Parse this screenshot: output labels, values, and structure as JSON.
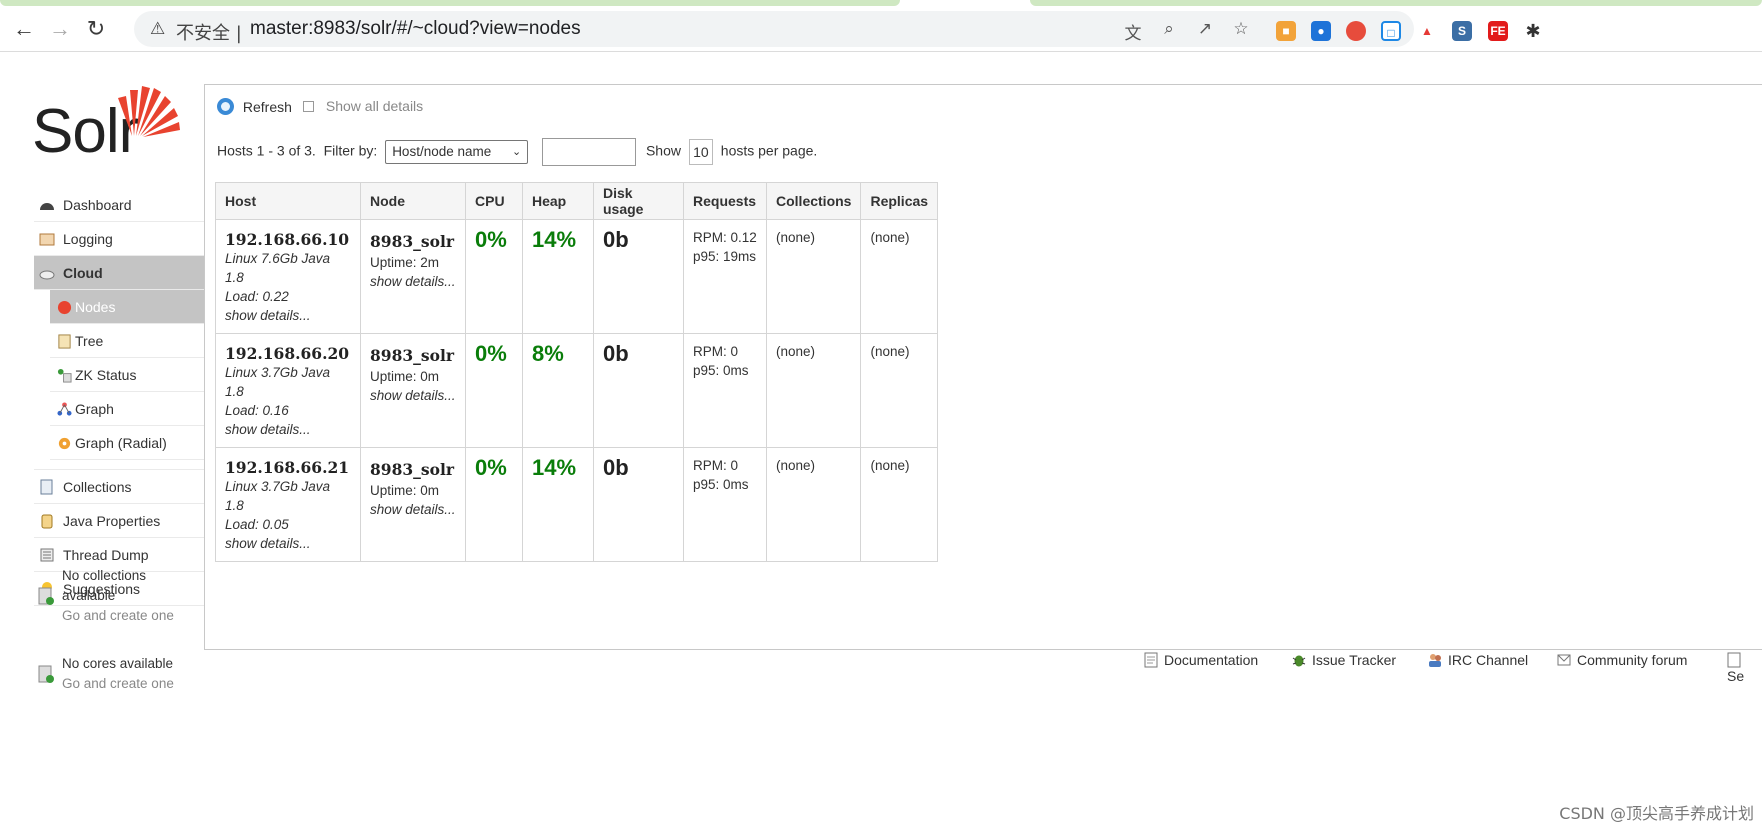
{
  "browser": {
    "insecure_label": "不安全 |",
    "url": "master:8983/solr/#/~cloud?view=nodes",
    "back_icon": "back-arrow-icon",
    "forward_icon": "forward-arrow-icon",
    "reload_icon": "reload-icon",
    "extension_colors": [
      "#f2a33a",
      "#1e73d8",
      "#e74c3c",
      "#1e88e5",
      "#e53935",
      "#3b6ea5",
      "#e21b1b",
      "#333333"
    ]
  },
  "logo": {
    "text": "Solr",
    "accent": "#e8432f"
  },
  "sidebar": {
    "items": [
      {
        "label": "Dashboard",
        "icon": "dashboard-icon"
      },
      {
        "label": "Logging",
        "icon": "logging-icon"
      },
      {
        "label": "Cloud",
        "icon": "cloud-icon",
        "active": true
      }
    ],
    "cloud_sub": [
      {
        "label": "Nodes",
        "icon": "nodes-icon",
        "active": true
      },
      {
        "label": "Tree",
        "icon": "tree-icon"
      },
      {
        "label": "ZK Status",
        "icon": "zk-status-icon"
      },
      {
        "label": "Graph",
        "icon": "graph-icon"
      },
      {
        "label": "Graph (Radial)",
        "icon": "graph-radial-icon"
      }
    ],
    "more_items": [
      {
        "label": "Collections",
        "icon": "collections-icon"
      },
      {
        "label": "Java Properties",
        "icon": "java-properties-icon"
      },
      {
        "label": "Thread Dump",
        "icon": "thread-dump-icon"
      },
      {
        "label": "Suggestions",
        "icon": "suggestions-icon"
      }
    ],
    "no_collections": "No collections available",
    "no_collections_link": "Go and create one",
    "no_cores": "No cores available",
    "no_cores_link": "Go and create one"
  },
  "toolbar": {
    "refresh_label": "Refresh",
    "show_all_label": "Show all details",
    "hosts_summary": "Hosts 1 - 3 of 3.",
    "filter_label": "Filter by:",
    "filter_value": "Host/node name",
    "filter_input": "",
    "show_label": "Show",
    "per_page": "10",
    "per_page_suffix": "hosts per page."
  },
  "table": {
    "headers": [
      "Host",
      "Node",
      "CPU",
      "Heap",
      "Disk usage",
      "Requests",
      "Collections",
      "Replicas"
    ],
    "rows": [
      {
        "host": "192.168.66.10",
        "os": "Linux 7.6Gb Java 1.8",
        "load": "Load: 0.22",
        "host_details": "show details...",
        "node": "8983_solr",
        "uptime": "Uptime: 2m",
        "node_details": "show details...",
        "cpu": "0%",
        "heap": "14%",
        "disk": "0b",
        "rpm": "RPM: 0.12",
        "p95": "p95: 19ms",
        "collections": "(none)",
        "replicas": "(none)"
      },
      {
        "host": "192.168.66.20",
        "os": "Linux 3.7Gb Java 1.8",
        "load": "Load: 0.16",
        "host_details": "show details...",
        "node": "8983_solr",
        "uptime": "Uptime: 0m",
        "node_details": "show details...",
        "cpu": "0%",
        "heap": "8%",
        "disk": "0b",
        "rpm": "RPM: 0",
        "p95": "p95: 0ms",
        "collections": "(none)",
        "replicas": "(none)"
      },
      {
        "host": "192.168.66.21",
        "os": "Linux 3.7Gb Java 1.8",
        "load": "Load: 0.05",
        "host_details": "show details...",
        "node": "8983_solr",
        "uptime": "Uptime: 0m",
        "node_details": "show details...",
        "cpu": "0%",
        "heap": "14%",
        "disk": "0b",
        "rpm": "RPM: 0",
        "p95": "p95: 0ms",
        "collections": "(none)",
        "replicas": "(none)"
      }
    ]
  },
  "footer": {
    "links": [
      {
        "label": "Documentation",
        "icon": "document-icon"
      },
      {
        "label": "Issue Tracker",
        "icon": "bug-icon"
      },
      {
        "label": "IRC Channel",
        "icon": "people-icon"
      },
      {
        "label": "Community forum",
        "icon": "mail-icon"
      },
      {
        "label": "Se",
        "icon": "code-icon"
      }
    ]
  },
  "watermark": "CSDN @顶尖高手养成计划"
}
